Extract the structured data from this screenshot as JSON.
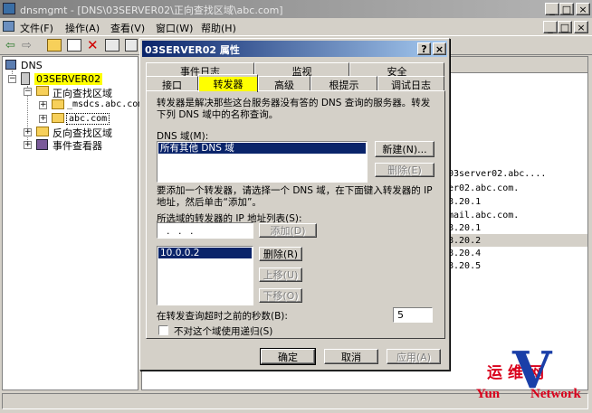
{
  "window": {
    "title": "dnsmgmt - [DNS\\03SERVER02\\正向查找区域\\abc.com]",
    "controls": [
      "_",
      "□",
      "×"
    ],
    "inner_controls": [
      "_",
      "□",
      "×"
    ]
  },
  "menu": [
    "文件(F)",
    "操作(A)",
    "查看(V)",
    "窗口(W)",
    "帮助(H)"
  ],
  "tree": {
    "root": "DNS",
    "server": "03SERVER02",
    "forward_zone": "正向查找区域",
    "msdcs": "_msdcs.abc.com",
    "abc": "abc.com",
    "reverse_zone": "反向查找区域",
    "event_viewer": "事件查看器"
  },
  "right_list": [
    "03server02.abc....",
    "er02.abc.com.",
    "8.20.1",
    "mail.abc.com.",
    "8.20.1",
    "8.20.2",
    "8.20.4",
    "8.20.5"
  ],
  "dialog": {
    "title": "03SERVER02 属性",
    "help": "?",
    "close": "×",
    "tabs_back": [
      "事件日志",
      "监视",
      "安全"
    ],
    "tabs_front": [
      "接口",
      "转发器",
      "高级",
      "根提示",
      "调试日志"
    ],
    "description": "转发器是解决那些这台服务器没有答的 DNS 查询的服务器。转发下列 DNS 域中的名称查询。",
    "dns_domain_label": "DNS 域(M):",
    "dns_domains": [
      "所有其他 DNS 域"
    ],
    "new_btn": "新建(N)...",
    "delete_btn1": "删除(E)",
    "add_instructions": "要添加一个转发器，请选择一个 DNS 域，在下面键入转发器的 IP 地址，然后单击“添加”。",
    "ip_list_label": "所选域的转发器的 IP 地址列表(S):",
    "ip_placeholder": ".     .     .",
    "add_btn": "添加(D)",
    "ip_list": [
      "10.0.0.2"
    ],
    "delete_btn2": "删除(R)",
    "up_btn": "上移(U)",
    "down_btn": "下移(O)",
    "timeout_label": "在转发查询超时之前的秒数(B):",
    "timeout_value": "5",
    "no_recursion_label": "不对这个域使用递归(S)",
    "ok_btn": "确定",
    "cancel_btn": "取消",
    "apply_btn": "应用(A)"
  },
  "watermark": {
    "cn": "运维网",
    "en_left": "Yun",
    "en_right": "Network",
    "colors": {
      "red": "#d9001b",
      "blue": "#1a3fa8"
    }
  }
}
